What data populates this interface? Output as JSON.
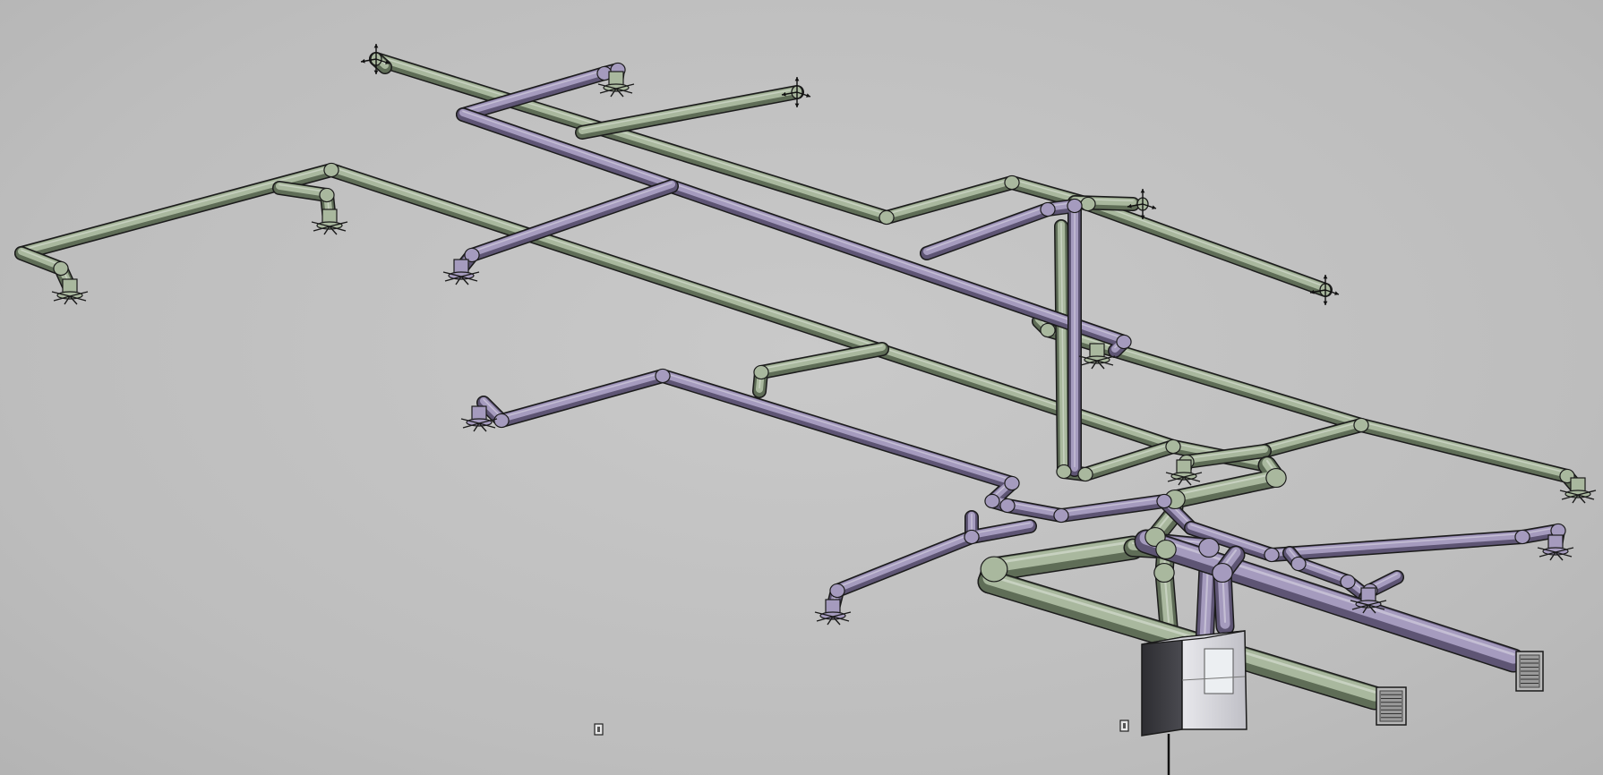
{
  "colors": {
    "background": "#c2c2c2",
    "supply_duct": "#a9b89e",
    "supply_shade": "#5f6d57",
    "exhaust_duct": "#a59bbe",
    "exhaust_shade": "#5e5574",
    "outline": "#1b1b1b",
    "unit_body": "#3a3a3e",
    "unit_panel": "#d6d6da",
    "grille": "#9a9a9a"
  },
  "icons": [
    "move-gizmo-icon",
    "diffuser-icon",
    "wall-grille-icon",
    "switch-icon"
  ]
}
